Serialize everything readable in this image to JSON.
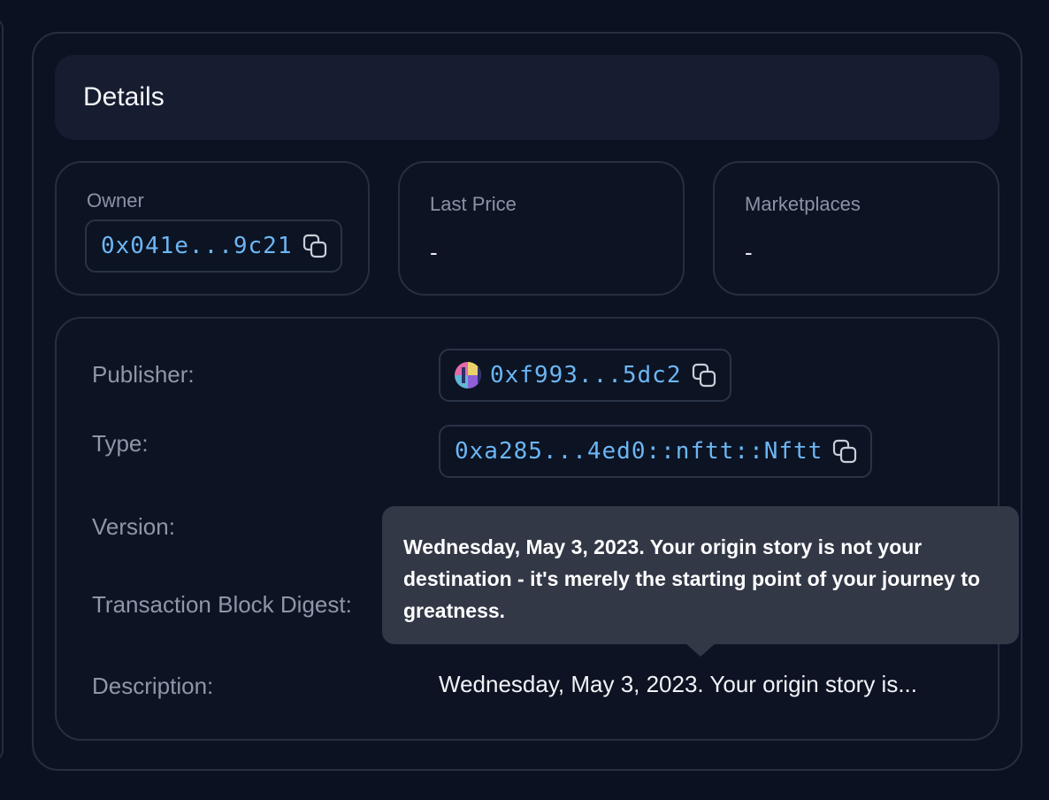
{
  "details": {
    "title": "Details",
    "owner": {
      "label": "Owner",
      "address": "0x041e...9c21"
    },
    "last_price": {
      "label": "Last Price",
      "value": "-"
    },
    "marketplaces": {
      "label": "Marketplaces",
      "value": "-"
    }
  },
  "rows": {
    "publisher": {
      "label": "Publisher:",
      "address": "0xf993...5dc2"
    },
    "type": {
      "label": "Type:",
      "value": "0xa285...4ed0::nftt::Nftt"
    },
    "version": {
      "label": "Version:"
    },
    "transaction": {
      "label": "Transaction Block Digest:"
    },
    "description": {
      "label": "Description:",
      "value": "Wednesday, May 3, 2023. Your origin story is..."
    }
  },
  "tooltip": {
    "text": "Wednesday, May 3, 2023. Your origin story is not your destination - it's merely the starting point of your journey to greatness."
  },
  "icons": [
    "copy-icon",
    "avatar"
  ],
  "colors": {
    "accent": "#6cb6f5",
    "background": "#0b1120",
    "tooltip": "#333847"
  }
}
